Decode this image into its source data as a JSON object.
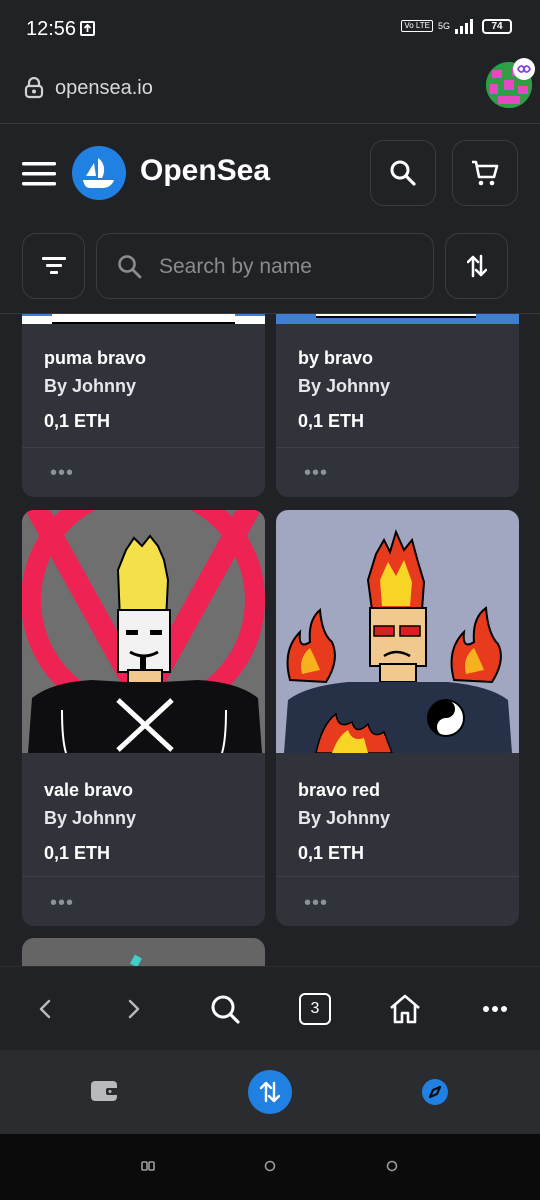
{
  "status": {
    "time": "12:56",
    "volte": "Vo LTE",
    "network": "5G",
    "battery": "74"
  },
  "browser": {
    "url": "opensea.io"
  },
  "header": {
    "brand": "OpenSea"
  },
  "filter": {
    "search_placeholder": "Search by name"
  },
  "cards": [
    {
      "title": "puma bravo",
      "owner": "By Johnny",
      "price": "0,1 ETH",
      "more": "•••"
    },
    {
      "title": "by bravo",
      "owner": "By Johnny",
      "price": "0,1 ETH",
      "more": "•••"
    },
    {
      "title": "vale bravo",
      "owner": "By Johnny",
      "price": "0,1 ETH",
      "more": "•••"
    },
    {
      "title": "bravo red",
      "owner": "By Johnny",
      "price": "0,1 ETH",
      "more": "•••"
    }
  ],
  "browser_nav": {
    "tab_count": "3"
  },
  "colors": {
    "accent": "#2081e2",
    "background": "#202225",
    "card": "#303339"
  }
}
